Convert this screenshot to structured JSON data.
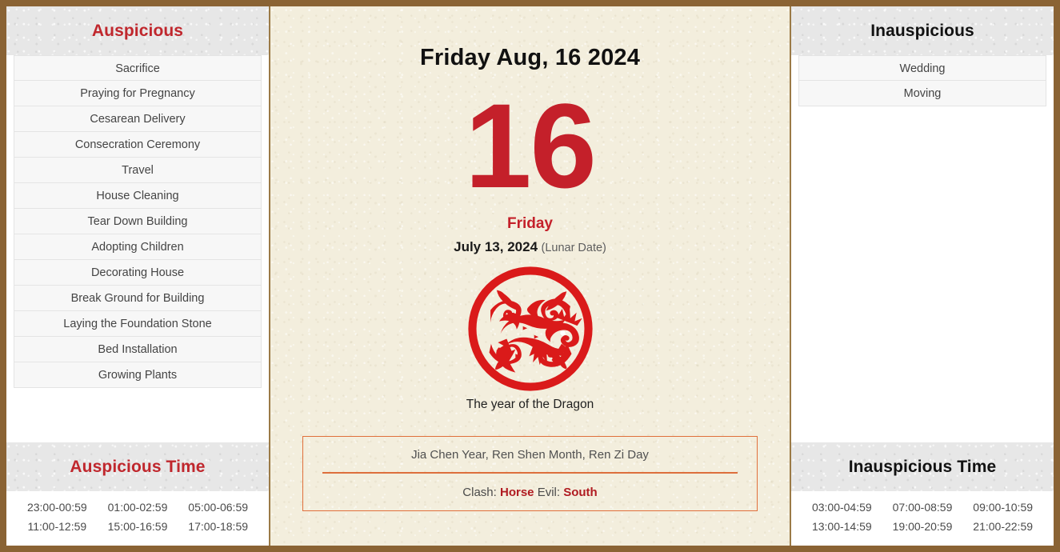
{
  "theme": {
    "frame_border": "#8a6334",
    "accent_red": "#c4202a",
    "header_red": "#c0272d",
    "info_border": "#e0703c",
    "paper_cream": "#f3eedd",
    "header_grey": "#e7e7e7"
  },
  "left_panel": {
    "header": "Auspicious",
    "items": [
      "Sacrifice",
      "Praying for Pregnancy",
      "Cesarean Delivery",
      "Consecration Ceremony",
      "Travel",
      "House Cleaning",
      "Tear Down Building",
      "Adopting Children",
      "Decorating House",
      "Break Ground for Building",
      "Laying the Foundation Stone",
      "Bed Installation",
      "Growing Plants"
    ],
    "time_header": "Auspicious Time",
    "times": [
      "23:00-00:59",
      "01:00-02:59",
      "05:00-06:59",
      "11:00-12:59",
      "15:00-16:59",
      "17:00-18:59"
    ]
  },
  "center_panel": {
    "gregorian_date": "Friday Aug, 16 2024",
    "day_number": "16",
    "weekday": "Friday",
    "lunar_date": "July 13, 2024",
    "lunar_tag": "(Lunar Date)",
    "zodiac_icon": "dragon-papercut-icon",
    "zodiac_caption": "The year of the Dragon",
    "ganzhi": "Jia Chen Year, Ren Shen Month, Ren Zi Day",
    "clash_label": "Clash:",
    "clash_value": "Horse",
    "evil_label": "Evil:",
    "evil_value": "South"
  },
  "right_panel": {
    "header": "Inauspicious",
    "items": [
      "Wedding",
      "Moving"
    ],
    "time_header": "Inauspicious Time",
    "times": [
      "03:00-04:59",
      "07:00-08:59",
      "09:00-10:59",
      "13:00-14:59",
      "19:00-20:59",
      "21:00-22:59"
    ]
  }
}
